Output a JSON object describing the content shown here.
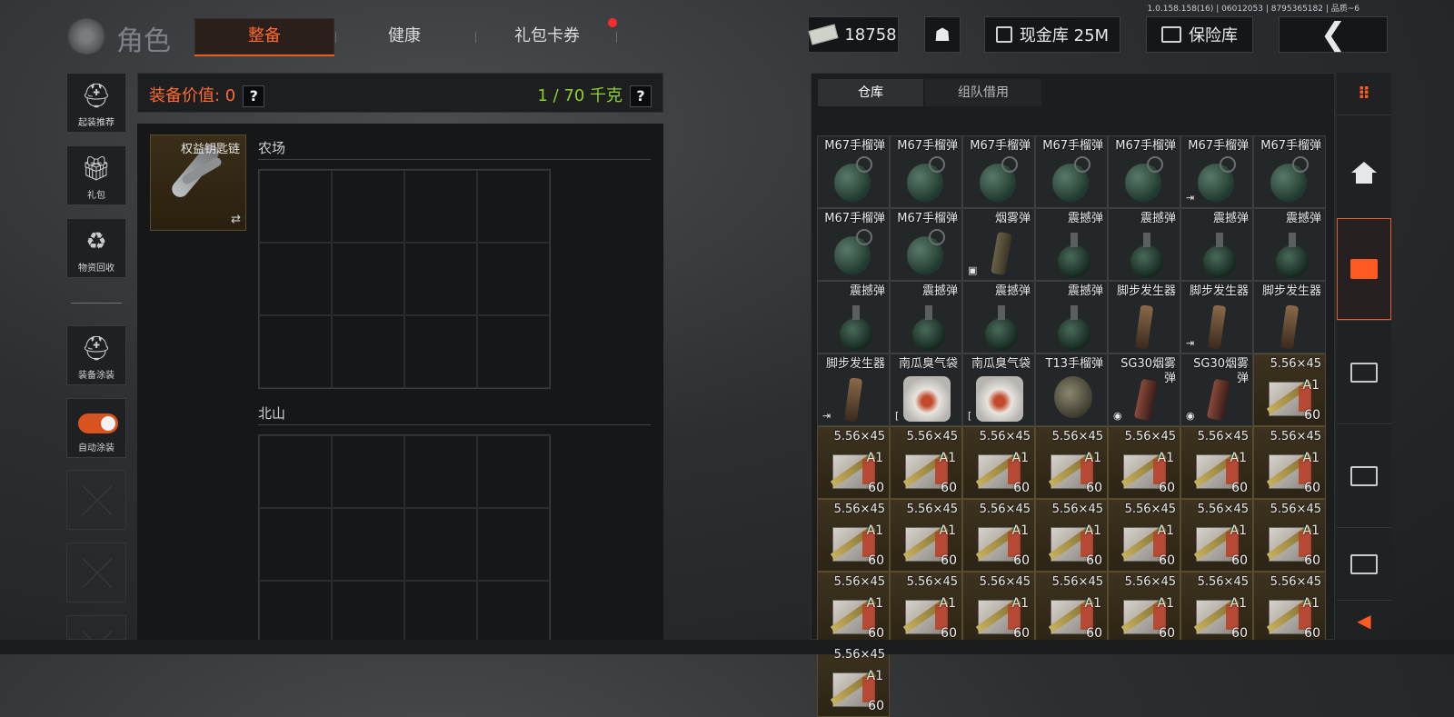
{
  "version_text": "1.0.158.158(16) | 06012053 | 8795365182 | 品质~6",
  "header": {
    "section_title": "角色",
    "tabs": [
      {
        "label": "整备",
        "active": true
      },
      {
        "label": "健康",
        "active": false
      },
      {
        "label": "礼包卡券",
        "active": false,
        "notification": true
      }
    ],
    "currency": "18758",
    "cash_vault_label": "现金库 25M",
    "safe_label": "保险库"
  },
  "sidebar": {
    "buttons": [
      {
        "label": "起装推荐",
        "icon": "helmet-icon"
      },
      {
        "label": "礼包",
        "icon": "gift-icon"
      },
      {
        "label": "物资回收",
        "icon": "recycle-icon"
      },
      {
        "label": "装备涂装",
        "icon": "helmet-paint-icon"
      },
      {
        "label": "自动涂装",
        "icon": "toggle-icon",
        "toggle_on": true
      }
    ]
  },
  "equipment": {
    "value_label": "装备价值: 0",
    "weight_label": "1 / 70 千克",
    "keychain_name": "权益钥匙链",
    "swap_glyph": "⇄",
    "sections": [
      "农场",
      "北山"
    ]
  },
  "warehouse": {
    "tabs": [
      {
        "label": "仓库",
        "active": true
      },
      {
        "label": "组队借用",
        "active": false
      }
    ],
    "items": [
      {
        "name": "M67手榴弹",
        "kind": "grenade"
      },
      {
        "name": "M67手榴弹",
        "kind": "grenade"
      },
      {
        "name": "M67手榴弹",
        "kind": "grenade"
      },
      {
        "name": "M67手榴弹",
        "kind": "grenade"
      },
      {
        "name": "M67手榴弹",
        "kind": "grenade"
      },
      {
        "name": "M67手榴弹",
        "kind": "grenade",
        "corner": "⇥"
      },
      {
        "name": "M67手榴弹",
        "kind": "grenade"
      },
      {
        "name": "M67手榴弹",
        "kind": "grenade"
      },
      {
        "name": "M67手榴弹",
        "kind": "grenade"
      },
      {
        "name": "烟雾弹",
        "kind": "smoke",
        "corner": "▣"
      },
      {
        "name": "震撼弹",
        "kind": "stun"
      },
      {
        "name": "震撼弹",
        "kind": "stun"
      },
      {
        "name": "震撼弹",
        "kind": "stun"
      },
      {
        "name": "震撼弹",
        "kind": "stun"
      },
      {
        "name": "震撼弹",
        "kind": "stun"
      },
      {
        "name": "震撼弹",
        "kind": "stun"
      },
      {
        "name": "震撼弹",
        "kind": "stun"
      },
      {
        "name": "震撼弹",
        "kind": "stun"
      },
      {
        "name": "脚步发生器",
        "kind": "launcher"
      },
      {
        "name": "脚步发生器",
        "kind": "launcher",
        "corner": "⇥"
      },
      {
        "name": "脚步发生器",
        "kind": "launcher"
      },
      {
        "name": "脚步发生器",
        "kind": "launcher",
        "corner": "⇥"
      },
      {
        "name": "南瓜臭气袋",
        "kind": "pumpkin",
        "corner": "["
      },
      {
        "name": "南瓜臭气袋",
        "kind": "pumpkin",
        "corner": "["
      },
      {
        "name": "T13手榴弹",
        "kind": "t13"
      },
      {
        "name": "SG30烟雾弹",
        "kind": "sg30",
        "corner": "◉"
      },
      {
        "name": "SG30烟雾弹",
        "kind": "sg30",
        "corner": "◉"
      },
      {
        "name": "5.56×45",
        "kind": "ammo",
        "sub": "A1",
        "count": "60"
      },
      {
        "name": "5.56×45",
        "kind": "ammo",
        "sub": "A1",
        "count": "60"
      },
      {
        "name": "5.56×45",
        "kind": "ammo",
        "sub": "A1",
        "count": "60"
      },
      {
        "name": "5.56×45",
        "kind": "ammo",
        "sub": "A1",
        "count": "60"
      },
      {
        "name": "5.56×45",
        "kind": "ammo",
        "sub": "A1",
        "count": "60"
      },
      {
        "name": "5.56×45",
        "kind": "ammo",
        "sub": "A1",
        "count": "60"
      },
      {
        "name": "5.56×45",
        "kind": "ammo",
        "sub": "A1",
        "count": "60"
      },
      {
        "name": "5.56×45",
        "kind": "ammo",
        "sub": "A1",
        "count": "60"
      },
      {
        "name": "5.56×45",
        "kind": "ammo",
        "sub": "A1",
        "count": "60"
      },
      {
        "name": "5.56×45",
        "kind": "ammo",
        "sub": "A1",
        "count": "60"
      },
      {
        "name": "5.56×45",
        "kind": "ammo",
        "sub": "A1",
        "count": "60"
      },
      {
        "name": "5.56×45",
        "kind": "ammo",
        "sub": "A1",
        "count": "60"
      },
      {
        "name": "5.56×45",
        "kind": "ammo",
        "sub": "A1",
        "count": "60"
      },
      {
        "name": "5.56×45",
        "kind": "ammo",
        "sub": "A1",
        "count": "60"
      },
      {
        "name": "5.56×45",
        "kind": "ammo",
        "sub": "A1",
        "count": "60"
      },
      {
        "name": "5.56×45",
        "kind": "ammo",
        "sub": "A1",
        "count": "60"
      },
      {
        "name": "5.56×45",
        "kind": "ammo",
        "sub": "A1",
        "count": "60"
      },
      {
        "name": "5.56×45",
        "kind": "ammo",
        "sub": "A1",
        "count": "60"
      },
      {
        "name": "5.56×45",
        "kind": "ammo",
        "sub": "A1",
        "count": "60"
      },
      {
        "name": "5.56×45",
        "kind": "ammo",
        "sub": "A1",
        "count": "60"
      },
      {
        "name": "5.56×45",
        "kind": "ammo",
        "sub": "A1",
        "count": "60"
      },
      {
        "name": "5.56×45",
        "kind": "ammo",
        "sub": "A1",
        "count": "60"
      },
      {
        "name": "5.56×45",
        "kind": "ammo",
        "sub": "A1",
        "count": "60"
      }
    ]
  },
  "right_nav": {
    "icons": [
      "grip-icon",
      "home-icon",
      "storage-box-icon",
      "storage-box-icon",
      "storage-box-icon",
      "storage-box-icon"
    ],
    "back_glyph": "◀"
  },
  "colors": {
    "accent": "#e65d23",
    "weight_green": "#8fd12a",
    "value_orange": "#ff6a2e"
  }
}
